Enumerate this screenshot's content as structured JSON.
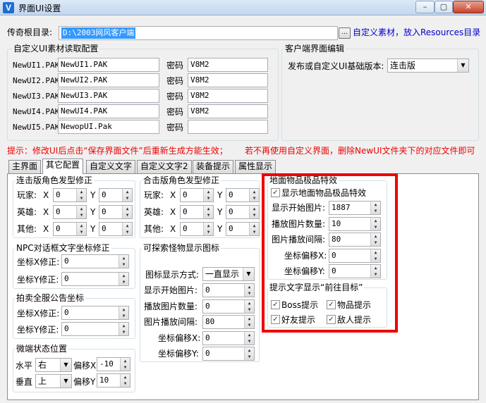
{
  "window": {
    "title": "界面UI设置",
    "icon": "V",
    "minimize": "–",
    "maximize": "▢",
    "close": "✕"
  },
  "root": {
    "label": "传奇根目录:",
    "value": "D:\\2003网风客户端",
    "browse": "...",
    "hint": "自定义素材，放入Resources目录"
  },
  "custom_ui": {
    "title": "自定义UI素材读取配置",
    "pwd_label": "密码",
    "rows": [
      {
        "name": "NewUI1.PAK",
        "file": "NewUI1.PAK",
        "pwd": "V8M2"
      },
      {
        "name": "NewUI2.PAK",
        "file": "NewUI2.PAK",
        "pwd": "V8M2"
      },
      {
        "name": "NewUI3.PAK",
        "file": "NewUI3.PAK",
        "pwd": "V8M2"
      },
      {
        "name": "NewUI4.PAK",
        "file": "NewUI4.PAK",
        "pwd": "V8M2"
      },
      {
        "name": "NewUI5.PAK",
        "file": "NewopUI.Pak",
        "pwd": ""
      }
    ]
  },
  "client": {
    "title": "客户端界面编辑",
    "label": "发布或自定义UI基础版本:",
    "version": "连击版"
  },
  "notice": {
    "text1": "提示：修改UI后点击“保存界面文件”后重新生成方能生效；",
    "text2": "若不再使用自定义界面，删除NewUI文件夹下的对应文件即可"
  },
  "tabs": [
    "主界面",
    "其它配置",
    "自定义文字",
    "自定义文字2",
    "装备提示",
    "属性显示"
  ],
  "combo_hair": {
    "title": "连击版角色发型修正",
    "rows": [
      {
        "label": "玩家:",
        "x": "0",
        "y": "0"
      },
      {
        "label": "英雄:",
        "x": "0",
        "y": "0"
      },
      {
        "label": "其他:",
        "x": "0",
        "y": "0"
      }
    ],
    "x": "X",
    "y": "Y"
  },
  "hit_hair": {
    "title": "合击版角色发型修正",
    "rows": [
      {
        "label": "玩家:",
        "x": "0",
        "y": "0"
      },
      {
        "label": "英雄:",
        "x": "0",
        "y": "0"
      },
      {
        "label": "其他:",
        "x": "0",
        "y": "0"
      }
    ],
    "x": "X",
    "y": "Y"
  },
  "npc": {
    "title": "NPC对话框文字坐标修正",
    "x_label": "坐标X修正:",
    "x": "0",
    "y_label": "坐标Y修正:",
    "y": "0"
  },
  "auction": {
    "title": "拍卖全服公告坐标",
    "x_label": "坐标X修正:",
    "x": "0",
    "y_label": "坐标Y修正:",
    "y": "0"
  },
  "micro": {
    "title": "微端状态位置",
    "h_label": "水平",
    "h_value": "右",
    "hx_label": "偏移X",
    "hx": "-10",
    "v_label": "垂直",
    "v_value": "上",
    "vy_label": "偏移Y",
    "vy": "10"
  },
  "monster": {
    "title": "可探索怪物显示图标",
    "mode_label": "图标显示方式:",
    "mode": "一直显示",
    "start_label": "显示开始图片:",
    "start": "0",
    "count_label": "播放图片数量:",
    "count": "0",
    "interval_label": "图片播放间隔:",
    "interval": "80",
    "ox_label": "坐标偏移X:",
    "ox": "0",
    "oy_label": "坐标偏移Y:",
    "oy": "0"
  },
  "ground": {
    "title": "地面物品极品特效",
    "enable_label": "显示地面物品极品特效",
    "start_label": "显示开始图片:",
    "start": "1887",
    "count_label": "播放图片数量:",
    "count": "10",
    "interval_label": "图片播放间隔:",
    "interval": "80",
    "ox_label": "坐标偏移X:",
    "ox": "0",
    "oy_label": "坐标偏移Y:",
    "oy": "0"
  },
  "text_display": {
    "title": "提示文字显示“前往目标”",
    "boss": "Boss提示",
    "item": "物品提示",
    "friend": "好友提示",
    "enemy": "敌人提示"
  },
  "check_mark": "✓",
  "spin_arrows": "▲▼",
  "dropdown_arrow": "▼"
}
